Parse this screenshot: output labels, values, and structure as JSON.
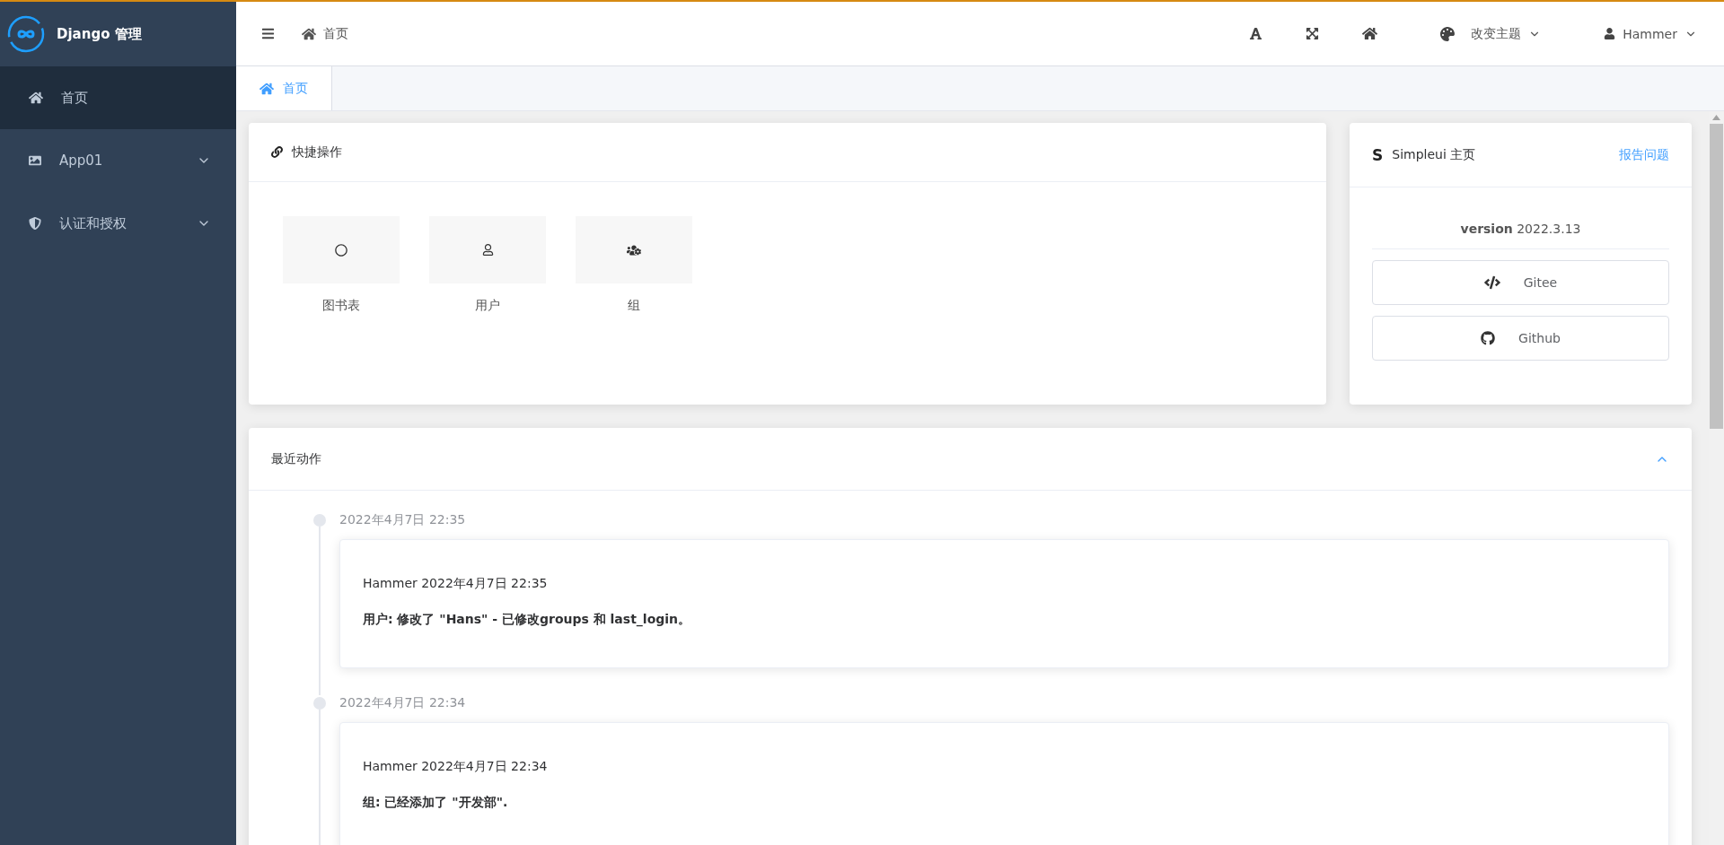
{
  "sidebar": {
    "logo_text": "Django 管理",
    "items": [
      {
        "label": "首页",
        "selected": true
      },
      {
        "label": "App01",
        "selected": false,
        "expanded": false
      },
      {
        "label": "认证和授权",
        "selected": false,
        "expanded": false
      }
    ]
  },
  "header": {
    "breadcrumb": "首页",
    "theme_label": "改变主题",
    "user": "Hammer"
  },
  "tabs": [
    {
      "label": "首页",
      "selected": true
    }
  ],
  "quick_actions": {
    "title": "快捷操作",
    "items": [
      {
        "label": "图书表"
      },
      {
        "label": "用户"
      },
      {
        "label": "组"
      }
    ]
  },
  "simpleui": {
    "logo": "S",
    "title": "Simpleui 主页",
    "report_link": "报告问题",
    "version": "**version** 2022.3.13",
    "buttons": [
      {
        "label": "Gitee"
      },
      {
        "label": "Github"
      }
    ]
  },
  "recent_actions": {
    "title": "最近动作",
    "expanded": true,
    "entries": [
      {
        "time": "2022年4月7日 22:35",
        "meta": "Hammer 2022年4月7日 22:35",
        "message": "用户: 修改了 \"Hans\" - 已修改groups 和 last_login。"
      },
      {
        "time": "2022年4月7日 22:34",
        "meta": "Hammer 2022年4月7日 22:34",
        "message": "组: 已经添加了 \"开发部\"."
      }
    ]
  }
}
